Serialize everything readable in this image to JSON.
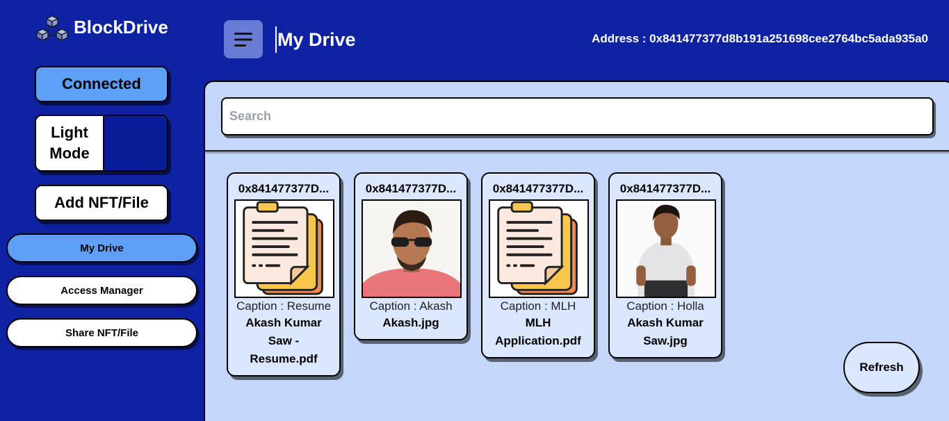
{
  "app": {
    "name": "BlockDrive"
  },
  "sidebar": {
    "connected_label": "Connected",
    "mode_label": "Light Mode",
    "add_label": "Add NFT/File",
    "nav": [
      {
        "label": "My Drive",
        "active": true
      },
      {
        "label": "Access Manager",
        "active": false
      },
      {
        "label": "Share NFT/File",
        "active": false
      }
    ]
  },
  "header": {
    "title": "My Drive",
    "address_label": "Address : 0x841477377d8b191a251698cee2764bc5ada935a0"
  },
  "search": {
    "placeholder": "Search"
  },
  "files": [
    {
      "owner": "0x841477377D...",
      "caption": "Caption : Resume",
      "filename": "Akash Kumar Saw - Resume.pdf",
      "thumb": "document-icon"
    },
    {
      "owner": "0x841477377D...",
      "caption": "Caption : Akash",
      "filename": "Akash.jpg",
      "thumb": "photo-sunglasses"
    },
    {
      "owner": "0x841477377D...",
      "caption": "Caption : MLH",
      "filename": "MLH Application.pdf",
      "thumb": "document-icon"
    },
    {
      "owner": "0x841477377D...",
      "caption": "Caption : Holla",
      "filename": "Akash Kumar Saw.jpg",
      "thumb": "photo-seated"
    }
  ],
  "refresh_label": "Refresh",
  "colors": {
    "background": "#0f23a2",
    "panel": "#c4d7fb",
    "accent": "#5ea0f8",
    "card": "#dbe6ff"
  }
}
